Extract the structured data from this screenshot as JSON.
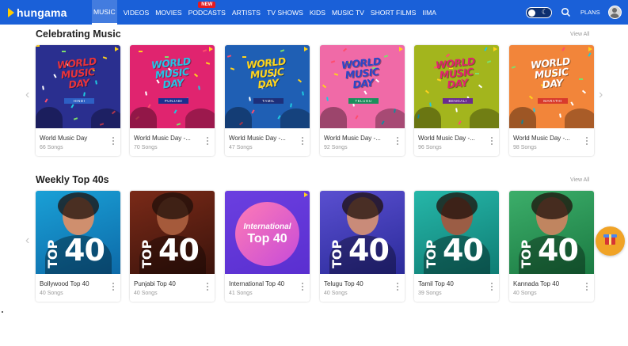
{
  "header": {
    "logo": "hungama",
    "nav": [
      {
        "label": "MUSIC",
        "active": true
      },
      {
        "label": "VIDEOS"
      },
      {
        "label": "MOVIES"
      },
      {
        "label": "PODCASTS",
        "badge": "NEW"
      },
      {
        "label": "ARTISTS"
      },
      {
        "label": "TV SHOWS"
      },
      {
        "label": "KIDS"
      },
      {
        "label": "MUSIC TV"
      },
      {
        "label": "SHORT FILMS"
      },
      {
        "label": "IIMA"
      }
    ],
    "theme_toggle_icon": "moon-icon",
    "search_icon": "search-icon",
    "plans_label": "PLANS",
    "avatar_icon": "user-avatar-icon"
  },
  "sections": [
    {
      "title": "Celebrating Music",
      "view_all": "View All",
      "cards": [
        {
          "title": "World Music Day",
          "subtitle": "66 Songs",
          "art_line1": "WORLD",
          "art_line2": "MUSIC",
          "art_line3": "DAY",
          "lang": "HINDI",
          "bg": "#2a2f8f",
          "text_color": "#e8333a",
          "tag_color": "#2d5fc4"
        },
        {
          "title": "World Music Day -...",
          "subtitle": "70 Songs",
          "art_line1": "WORLD",
          "art_line2": "MUSIC",
          "art_line3": "DAY",
          "lang": "PUNJABI",
          "bg": "#e0246f",
          "text_color": "#26c3e6",
          "tag_color": "#1b2f8f"
        },
        {
          "title": "World Music Day -...",
          "subtitle": "47 Songs",
          "art_line1": "WORLD",
          "art_line2": "MUSIC",
          "art_line3": "DAY",
          "lang": "TAMIL",
          "bg": "#1f5fb4",
          "text_color": "#ffd41d",
          "tag_color": "#1d2f7a"
        },
        {
          "title": "World Music Day -...",
          "subtitle": "92 Songs",
          "art_line1": "WORLD",
          "art_line2": "MUSIC",
          "art_line3": "DAY",
          "lang": "TELUGU",
          "bg": "#f06aa7",
          "text_color": "#2a48c8",
          "tag_color": "#1b8f5c"
        },
        {
          "title": "World Music Day -...",
          "subtitle": "96 Songs",
          "art_line1": "WORLD",
          "art_line2": "MUSIC",
          "art_line3": "DAY",
          "lang": "BENGALI",
          "bg": "#a3b51d",
          "text_color": "#e0246f",
          "tag_color": "#6a2b8f"
        },
        {
          "title": "World Music Day -...",
          "subtitle": "98 Songs",
          "art_line1": "WORLD",
          "art_line2": "MUSIC",
          "art_line3": "DAY",
          "lang": "MARATHI",
          "bg": "#f2853a",
          "text_color": "#ffffff",
          "tag_color": "#d83a2c"
        }
      ]
    },
    {
      "title": "Weekly Top 40s",
      "view_all": "View All",
      "cards": [
        {
          "title": "Bollywood Top 40",
          "subtitle": "40 Songs",
          "top": "TOP",
          "num": "40",
          "bg": "#1aa0d6",
          "bg2": "#0d6aa8",
          "figure": "#cf8f6e"
        },
        {
          "title": "Punjabi Top 40",
          "subtitle": "40 Songs",
          "top": "TOP",
          "num": "40",
          "bg": "#7a2a18",
          "bg2": "#3b130b",
          "figure": "#a55a3b"
        },
        {
          "title": "International Top 40",
          "subtitle": "41 Songs",
          "intl_line1": "International",
          "intl_line2": "Top 40",
          "bg": "#6b3fe0",
          "bg2": "#5a2fd0"
        },
        {
          "title": "Telugu Top 40",
          "subtitle": "40 Songs",
          "top": "TOP",
          "num": "40",
          "bg": "#5a4fd0",
          "bg2": "#2b2b9a",
          "figure": "#c98b79"
        },
        {
          "title": "Tamil Top 40",
          "subtitle": "39 Songs",
          "top": "TOP",
          "num": "40",
          "bg": "#26b7a9",
          "bg2": "#0f7d74",
          "figure": "#9b5d45"
        },
        {
          "title": "Kannada Top 40",
          "subtitle": "40 Songs",
          "top": "TOP",
          "num": "40",
          "bg": "#3cae6a",
          "bg2": "#1b7a42",
          "figure": "#c08560"
        }
      ]
    }
  ],
  "arrows": {
    "left": "‹",
    "right": "›"
  },
  "gift_icon": "gift-icon"
}
